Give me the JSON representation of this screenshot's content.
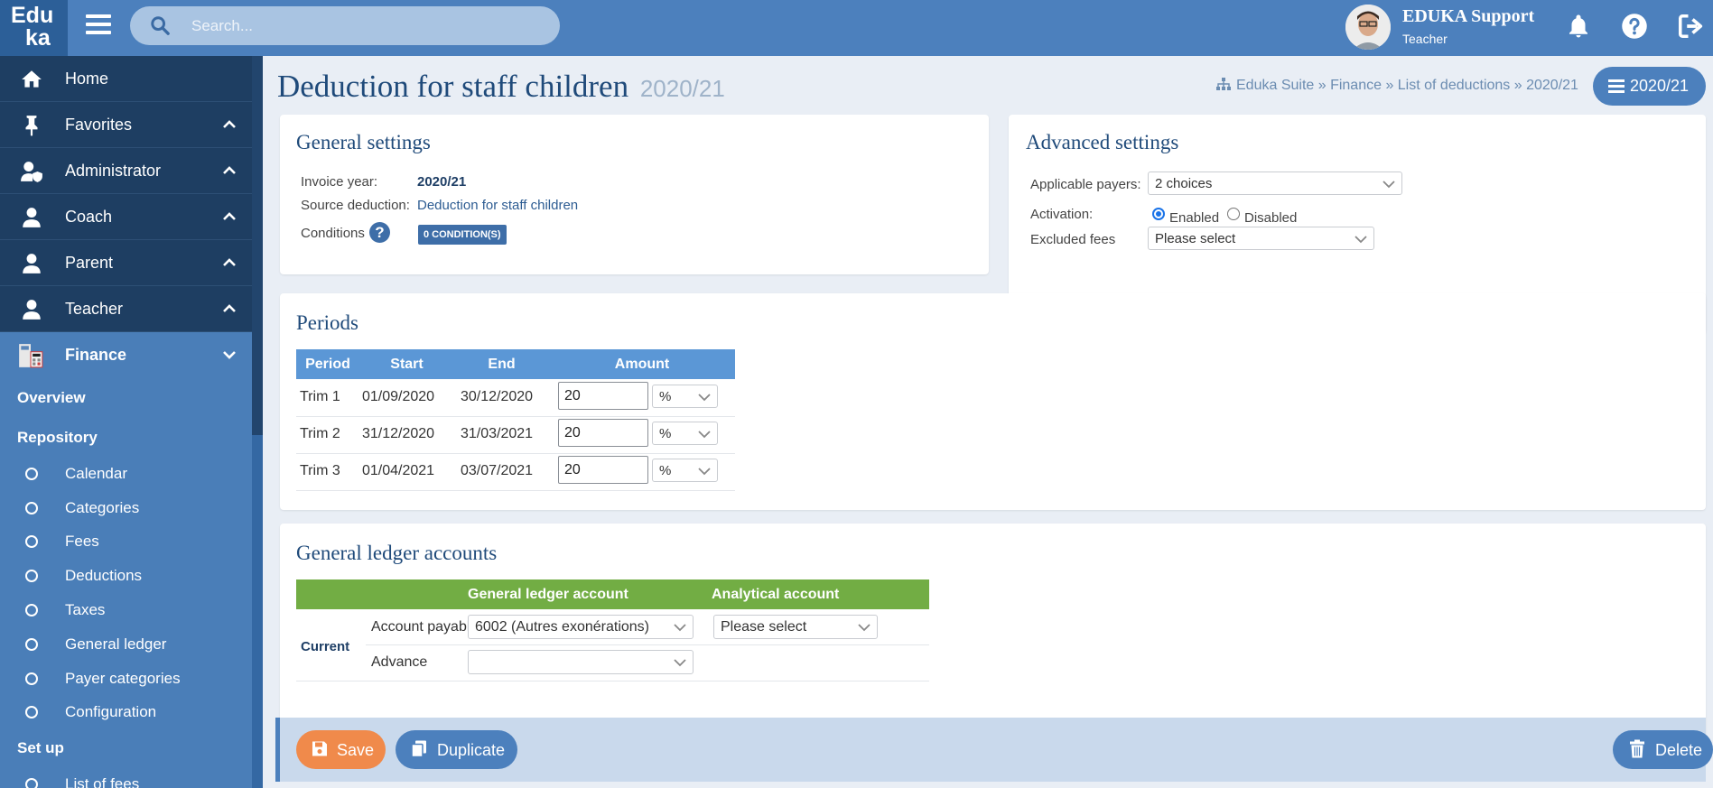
{
  "topbar": {
    "logo_line1": "Edu",
    "logo_line2": "ka",
    "search_placeholder": "Search...",
    "user_name": "EDUKA Support",
    "user_role": "Teacher"
  },
  "sidebar": {
    "nav": [
      {
        "label": "Home",
        "icon": "home-icon"
      },
      {
        "label": "Favorites",
        "icon": "pin-icon"
      },
      {
        "label": "Administrator",
        "icon": "admin-user-icon"
      },
      {
        "label": "Coach",
        "icon": "user-icon"
      },
      {
        "label": "Parent",
        "icon": "user-icon"
      },
      {
        "label": "Teacher",
        "icon": "user-icon"
      },
      {
        "label": "Finance",
        "icon": "calculator-icon"
      }
    ],
    "overview": "Overview",
    "repository": "Repository",
    "repo_items": [
      "Calendar",
      "Categories",
      "Fees",
      "Deductions",
      "Taxes",
      "General ledger",
      "Payer categories",
      "Configuration"
    ],
    "setup": "Set up",
    "setup_items": [
      "List of fees"
    ]
  },
  "page": {
    "title": "Deduction for staff children",
    "title_year": "2020/21",
    "breadcrumb": "Eduka Suite » Finance » List of deductions » 2020/21",
    "year_button": "2020/21"
  },
  "general": {
    "title": "General settings",
    "invoice_year_label": "Invoice year:",
    "invoice_year": "2020/21",
    "source_label": "Source deduction:",
    "source": "Deduction for staff children",
    "conditions_label": "Conditions",
    "conditions_badge": "0 CONDITION(S)"
  },
  "advanced": {
    "title": "Advanced settings",
    "payers_label": "Applicable payers:",
    "payers_value": "2 choices",
    "activation_label": "Activation:",
    "enabled_label": "Enabled",
    "disabled_label": "Disabled",
    "activation": "Enabled",
    "excluded_label": "Excluded fees",
    "excluded_value": "Please select"
  },
  "periods": {
    "title": "Periods",
    "headers": [
      "Period",
      "Start",
      "End",
      "Amount"
    ],
    "rows": [
      {
        "period": "Trim 1",
        "start": "01/09/2020",
        "end": "30/12/2020",
        "amount": "20",
        "unit": "%"
      },
      {
        "period": "Trim 2",
        "start": "31/12/2020",
        "end": "31/03/2021",
        "amount": "20",
        "unit": "%"
      },
      {
        "period": "Trim 3",
        "start": "01/04/2021",
        "end": "03/07/2021",
        "amount": "20",
        "unit": "%"
      }
    ]
  },
  "ledger": {
    "title": "General ledger accounts",
    "headers": [
      "General ledger account",
      "Analytical account"
    ],
    "group": "Current",
    "rows": [
      {
        "label": "Account payable",
        "account": "6002 (Autres exonérations)",
        "analytical": "Please select"
      },
      {
        "label": "Advance",
        "account": "",
        "analytical": ""
      }
    ]
  },
  "actions": {
    "save": "Save",
    "duplicate": "Duplicate",
    "delete": "Delete"
  },
  "colors": {
    "primary": "#4c80bd",
    "sidebar_dark": "#1e3e62",
    "periods_header": "#5b97d6",
    "ledger_header": "#72ad44",
    "save": "#f08a4b"
  }
}
